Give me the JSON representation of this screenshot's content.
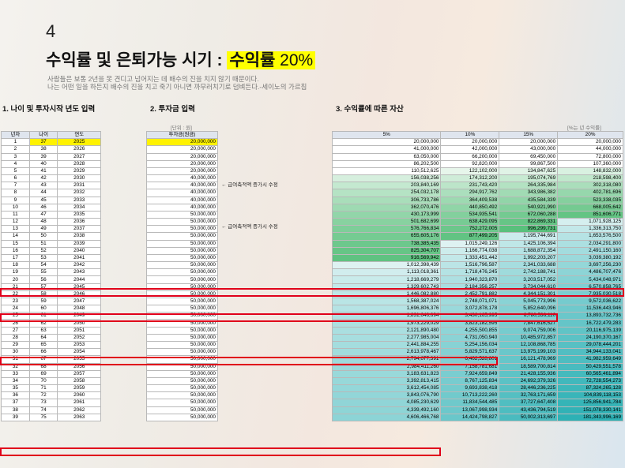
{
  "slide_number": "4",
  "title": {
    "main": "수익률 및 은퇴가능 시기 : ",
    "highlight": "수익률",
    "rate": " 20%"
  },
  "quote": {
    "line1": "사람들은 보통 2년을 못 견디고 넘어지는 데 배수의 진을 치지 않기 때문이다.",
    "line2": "나는 어떤 일을 하든지 배수의 진을 치고 죽기 아니면 까무러치기로 덤벼든다.-세이노의 가르침"
  },
  "sections": {
    "s1": "1. 나이 및 투자시작 년도 입력",
    "s2": "2. 투자금 입력",
    "s3": "3. 수익률에 따른 자산"
  },
  "units": {
    "investment": "[단위 : 원]",
    "return": "[%는 년 수익률]"
  },
  "age_table": {
    "headers": [
      "년차",
      "나이",
      "연도"
    ],
    "rows": [
      [
        "1",
        "37",
        "2025"
      ],
      [
        "2",
        "38",
        "2026"
      ],
      [
        "3",
        "39",
        "2027"
      ],
      [
        "4",
        "40",
        "2028"
      ],
      [
        "5",
        "41",
        "2029"
      ],
      [
        "6",
        "42",
        "2030"
      ],
      [
        "7",
        "43",
        "2031"
      ],
      [
        "8",
        "44",
        "2032"
      ],
      [
        "9",
        "45",
        "2033"
      ],
      [
        "10",
        "46",
        "2034"
      ],
      [
        "11",
        "47",
        "2035"
      ],
      [
        "12",
        "48",
        "2036"
      ],
      [
        "13",
        "49",
        "2037"
      ],
      [
        "14",
        "50",
        "2038"
      ],
      [
        "15",
        "51",
        "2039"
      ],
      [
        "16",
        "52",
        "2040"
      ],
      [
        "17",
        "53",
        "2041"
      ],
      [
        "18",
        "54",
        "2042"
      ],
      [
        "19",
        "55",
        "2043"
      ],
      [
        "20",
        "56",
        "2044"
      ],
      [
        "21",
        "57",
        "2045"
      ],
      [
        "22",
        "58",
        "2046"
      ],
      [
        "23",
        "59",
        "2047"
      ],
      [
        "24",
        "60",
        "2048"
      ],
      [
        "25",
        "61",
        "2049"
      ],
      [
        "26",
        "62",
        "2050"
      ],
      [
        "27",
        "63",
        "2051"
      ],
      [
        "28",
        "64",
        "2052"
      ],
      [
        "29",
        "65",
        "2053"
      ],
      [
        "30",
        "66",
        "2054"
      ],
      [
        "31",
        "67",
        "2055"
      ],
      [
        "32",
        "68",
        "2056"
      ],
      [
        "33",
        "69",
        "2057"
      ],
      [
        "34",
        "70",
        "2058"
      ],
      [
        "35",
        "71",
        "2059"
      ],
      [
        "36",
        "72",
        "2060"
      ],
      [
        "37",
        "73",
        "2061"
      ],
      [
        "38",
        "74",
        "2062"
      ],
      [
        "39",
        "75",
        "2063"
      ]
    ]
  },
  "investment_table": {
    "header": "투자금(원금)",
    "values": [
      "20,000,000",
      "20,000,000",
      "20,000,000",
      "20,000,000",
      "20,000,000",
      "40,000,000",
      "40,000,000",
      "40,000,000",
      "40,000,000",
      "40,000,000",
      "50,000,000",
      "50,000,000",
      "50,000,000",
      "50,000,000",
      "50,000,000",
      "50,000,000",
      "50,000,000",
      "50,000,000",
      "50,000,000",
      "50,000,000",
      "50,000,000",
      "50,000,000",
      "50,000,000",
      "50,000,000",
      "50,000,000",
      "50,000,000",
      "50,000,000",
      "50,000,000",
      "50,000,000",
      "50,000,000",
      "50,000,000",
      "50,000,000",
      "50,000,000",
      "50,000,000",
      "50,000,000",
      "50,000,000",
      "50,000,000",
      "50,000,000",
      "50,000,000"
    ]
  },
  "notes": {
    "note1": "← 급여축적액 증가시 수정",
    "note2": "← 급여축적액 증가시 수정"
  },
  "return_table": {
    "headers": [
      "5%",
      "10%",
      "15%",
      "20%"
    ],
    "rows": [
      [
        "20,000,000",
        "20,000,000",
        "20,000,000",
        "20,000,000"
      ],
      [
        "41,000,000",
        "42,000,000",
        "43,000,000",
        "44,000,000"
      ],
      [
        "63,050,000",
        "66,200,000",
        "69,450,000",
        "72,800,000"
      ],
      [
        "86,202,500",
        "92,820,000",
        "99,867,500",
        "107,360,000"
      ],
      [
        "110,512,625",
        "122,102,000",
        "134,847,625",
        "148,832,000"
      ],
      [
        "156,038,256",
        "174,312,200",
        "195,074,769",
        "218,598,400"
      ],
      [
        "203,840,169",
        "231,743,420",
        "264,335,984",
        "302,318,080"
      ],
      [
        "254,032,178",
        "294,917,762",
        "343,986,382",
        "402,781,696"
      ],
      [
        "306,733,786",
        "364,409,538",
        "435,584,339",
        "523,338,035"
      ],
      [
        "362,070,476",
        "440,850,492",
        "540,921,990",
        "668,005,642"
      ],
      [
        "430,173,999",
        "534,935,541",
        "672,060,288",
        "851,606,771"
      ],
      [
        "501,682,699",
        "638,429,095",
        "822,869,331",
        "1,071,928,125"
      ],
      [
        "576,766,834",
        "752,272,005",
        "996,299,731",
        "1,336,313,750"
      ],
      [
        "655,605,176",
        "877,499,205",
        "1,195,744,691",
        "1,653,576,500"
      ],
      [
        "738,385,435",
        "1,015,249,126",
        "1,425,106,394",
        "2,034,291,800"
      ],
      [
        "825,304,707",
        "1,166,774,038",
        "1,688,872,354",
        "2,491,150,160"
      ],
      [
        "916,569,942",
        "1,333,451,442",
        "1,992,203,207",
        "3,039,380,192"
      ],
      [
        "1,012,398,439",
        "1,516,796,587",
        "2,341,033,688",
        "3,697,256,230"
      ],
      [
        "1,113,018,361",
        "1,718,476,245",
        "2,742,188,741",
        "4,486,707,476"
      ],
      [
        "1,218,669,279",
        "1,940,323,870",
        "3,203,517,052",
        "5,434,048,971"
      ],
      [
        "1,329,602,743",
        "2,184,356,257",
        "3,734,044,610",
        "6,570,858,765"
      ],
      [
        "1,446,082,880",
        "2,452,791,882",
        "4,344,151,301",
        "7,935,030,518"
      ],
      [
        "1,568,387,024",
        "2,748,071,071",
        "5,045,773,996",
        "9,572,036,622"
      ],
      [
        "1,696,806,376",
        "3,072,878,178",
        "5,852,640,096",
        "11,536,443,946"
      ],
      [
        "1,831,646,694",
        "3,430,165,995",
        "6,780,536,110",
        "13,893,732,736"
      ],
      [
        "1,973,229,029",
        "3,823,182,595",
        "7,847,616,527",
        "16,722,479,283"
      ],
      [
        "2,121,890,480",
        "4,255,500,855",
        "9,074,759,006",
        "20,116,975,139"
      ],
      [
        "2,277,985,004",
        "4,731,050,940",
        "10,485,972,857",
        "24,190,370,167"
      ],
      [
        "2,441,884,255",
        "5,254,156,034",
        "12,108,868,785",
        "29,078,444,201"
      ],
      [
        "2,613,978,467",
        "5,829,571,637",
        "13,975,199,103",
        "34,944,133,041"
      ],
      [
        "2,794,677,391",
        "6,462,528,801",
        "16,121,478,969",
        "41,982,959,649"
      ],
      [
        "2,984,411,260",
        "7,158,781,681",
        "18,589,700,814",
        "50,429,551,578"
      ],
      [
        "3,183,631,823",
        "7,924,659,849",
        "21,428,155,936",
        "60,565,461,894"
      ],
      [
        "3,392,813,415",
        "8,767,125,834",
        "24,692,379,326",
        "72,728,554,273"
      ],
      [
        "3,612,454,085",
        "9,693,838,418",
        "28,446,236,225",
        "87,324,265,128"
      ],
      [
        "3,843,076,790",
        "10,713,222,260",
        "32,763,171,659",
        "104,839,118,153"
      ],
      [
        "4,085,230,629",
        "11,834,544,485",
        "37,727,647,408",
        "125,856,941,784"
      ],
      [
        "4,339,492,160",
        "13,067,998,934",
        "43,436,794,519",
        "151,078,330,141"
      ],
      [
        "4,606,466,768",
        "14,424,798,827",
        "50,002,313,697",
        "181,343,996,169"
      ]
    ]
  },
  "colors": {
    "highlight_yellow": "#fff200",
    "box_red": "#e0001a",
    "green_dark": "#59c07c",
    "green_light": "#e8f6ec",
    "teal_dark": "#2bb0b4",
    "teal_light": "#e3f4f4"
  }
}
